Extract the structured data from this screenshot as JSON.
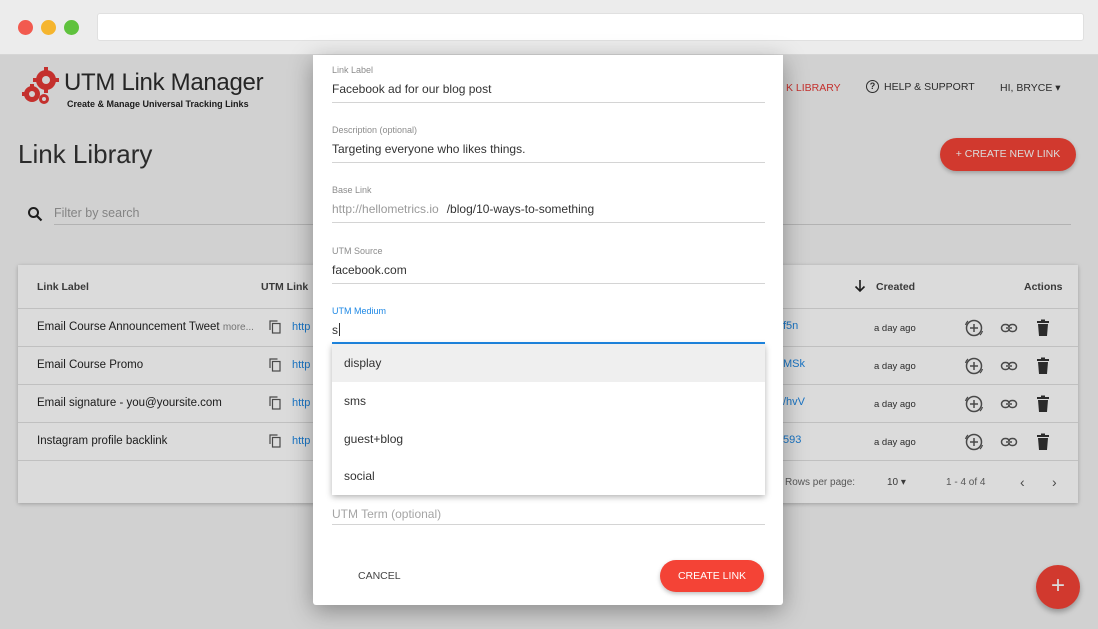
{
  "app": {
    "title": "UTM Link Manager",
    "subtitle": "Create & Manage Universal Tracking Links"
  },
  "nav": {
    "library": "K LIBRARY",
    "help": "HELP & SUPPORT",
    "user": "HI, BRYCE"
  },
  "page": {
    "title": "Link Library",
    "create_button": "+ CREATE NEW LINK",
    "search_placeholder": "Filter by search"
  },
  "table": {
    "headers": {
      "label": "Link Label",
      "utm": "UTM Link",
      "created": "Created",
      "actions": "Actions"
    },
    "rows": [
      {
        "label": "Email Course Announcement Tweet",
        "more": "more...",
        "link_prefix": "http",
        "link_suffix": "f5n",
        "created": "a day ago"
      },
      {
        "label": "Email Course Promo",
        "more": "",
        "link_prefix": "http",
        "link_suffix": "MSk",
        "created": "a day ago"
      },
      {
        "label": "Email signature - you@yoursite.com",
        "more": "",
        "link_prefix": "http",
        "link_suffix": "/hvV",
        "created": "a day ago"
      },
      {
        "label": "Instagram profile backlink",
        "more": "",
        "link_prefix": "http",
        "link_suffix": "593",
        "created": "a day ago"
      }
    ],
    "footer": {
      "rows_per_page_label": "Rows per page:",
      "rows_per_page": "10",
      "range": "1 - 4 of 4"
    }
  },
  "fab": "+",
  "modal": {
    "link_label": {
      "label": "Link Label",
      "value": "Facebook ad for our blog post"
    },
    "description": {
      "label": "Description (optional)",
      "value": "Targeting everyone who likes things."
    },
    "base_link": {
      "label": "Base Link",
      "prefix": "http://hellometrics.io",
      "value": "/blog/10-ways-to-something"
    },
    "utm_source": {
      "label": "UTM Source",
      "value": "facebook.com"
    },
    "utm_medium": {
      "label": "UTM Medium",
      "value": "s"
    },
    "utm_term": {
      "placeholder": "UTM Term (optional)"
    },
    "dropdown": [
      "display",
      "sms",
      "guest+blog",
      "social"
    ],
    "cancel": "CANCEL",
    "create": "CREATE LINK"
  },
  "colors": {
    "accent": "#f44336",
    "link": "#1e88e5"
  }
}
